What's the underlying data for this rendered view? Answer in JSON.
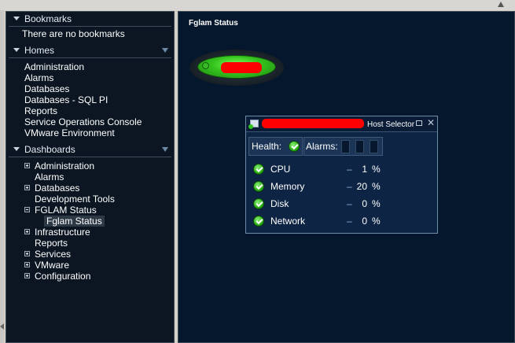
{
  "bookmarks": {
    "title": "Bookmarks",
    "empty_text": "There are no bookmarks"
  },
  "homes": {
    "title": "Homes",
    "items": [
      {
        "label": "Administration"
      },
      {
        "label": "Alarms"
      },
      {
        "label": "Databases"
      },
      {
        "label": "Databases - SQL PI"
      },
      {
        "label": "Reports"
      },
      {
        "label": "Service Operations Console"
      },
      {
        "label": "VMware Environment"
      }
    ]
  },
  "dashboards": {
    "title": "Dashboards",
    "items": [
      {
        "label": "Administration",
        "toggle": "plus"
      },
      {
        "label": "Alarms",
        "toggle": "none"
      },
      {
        "label": "Databases",
        "toggle": "plus"
      },
      {
        "label": "Development Tools",
        "toggle": "none"
      },
      {
        "label": "FGLAM Status",
        "toggle": "minus"
      },
      {
        "label": "Fglam Status",
        "toggle": "child",
        "selected": true
      },
      {
        "label": "Infrastructure",
        "toggle": "plus"
      },
      {
        "label": "Reports",
        "toggle": "none"
      },
      {
        "label": "Services",
        "toggle": "plus"
      },
      {
        "label": "VMware",
        "toggle": "plus"
      },
      {
        "label": "Configuration",
        "toggle": "plus"
      }
    ]
  },
  "main": {
    "title": "Fglam Status"
  },
  "host_selector": {
    "title": "Host Selector",
    "health_label": "Health:",
    "alarms_label": "Alarms:",
    "metrics": [
      {
        "name": "CPU",
        "dash": "–",
        "value": "1",
        "unit": "%"
      },
      {
        "name": "Memory",
        "dash": "–",
        "value": "20",
        "unit": "%"
      },
      {
        "name": "Disk",
        "dash": "–",
        "value": "0",
        "unit": "%"
      },
      {
        "name": "Network",
        "dash": "–",
        "value": "0",
        "unit": "%"
      }
    ]
  },
  "icons": {
    "collapse": "triangle-down-icon",
    "filter": "filter-icon",
    "health": "green-check-icon",
    "restore": "restore-icon",
    "close": "close-icon"
  },
  "colors": {
    "sidebar_bg": "#0b1622",
    "main_bg": "#04172d",
    "status_green": "#34c21e",
    "redaction": "#ff0000"
  }
}
